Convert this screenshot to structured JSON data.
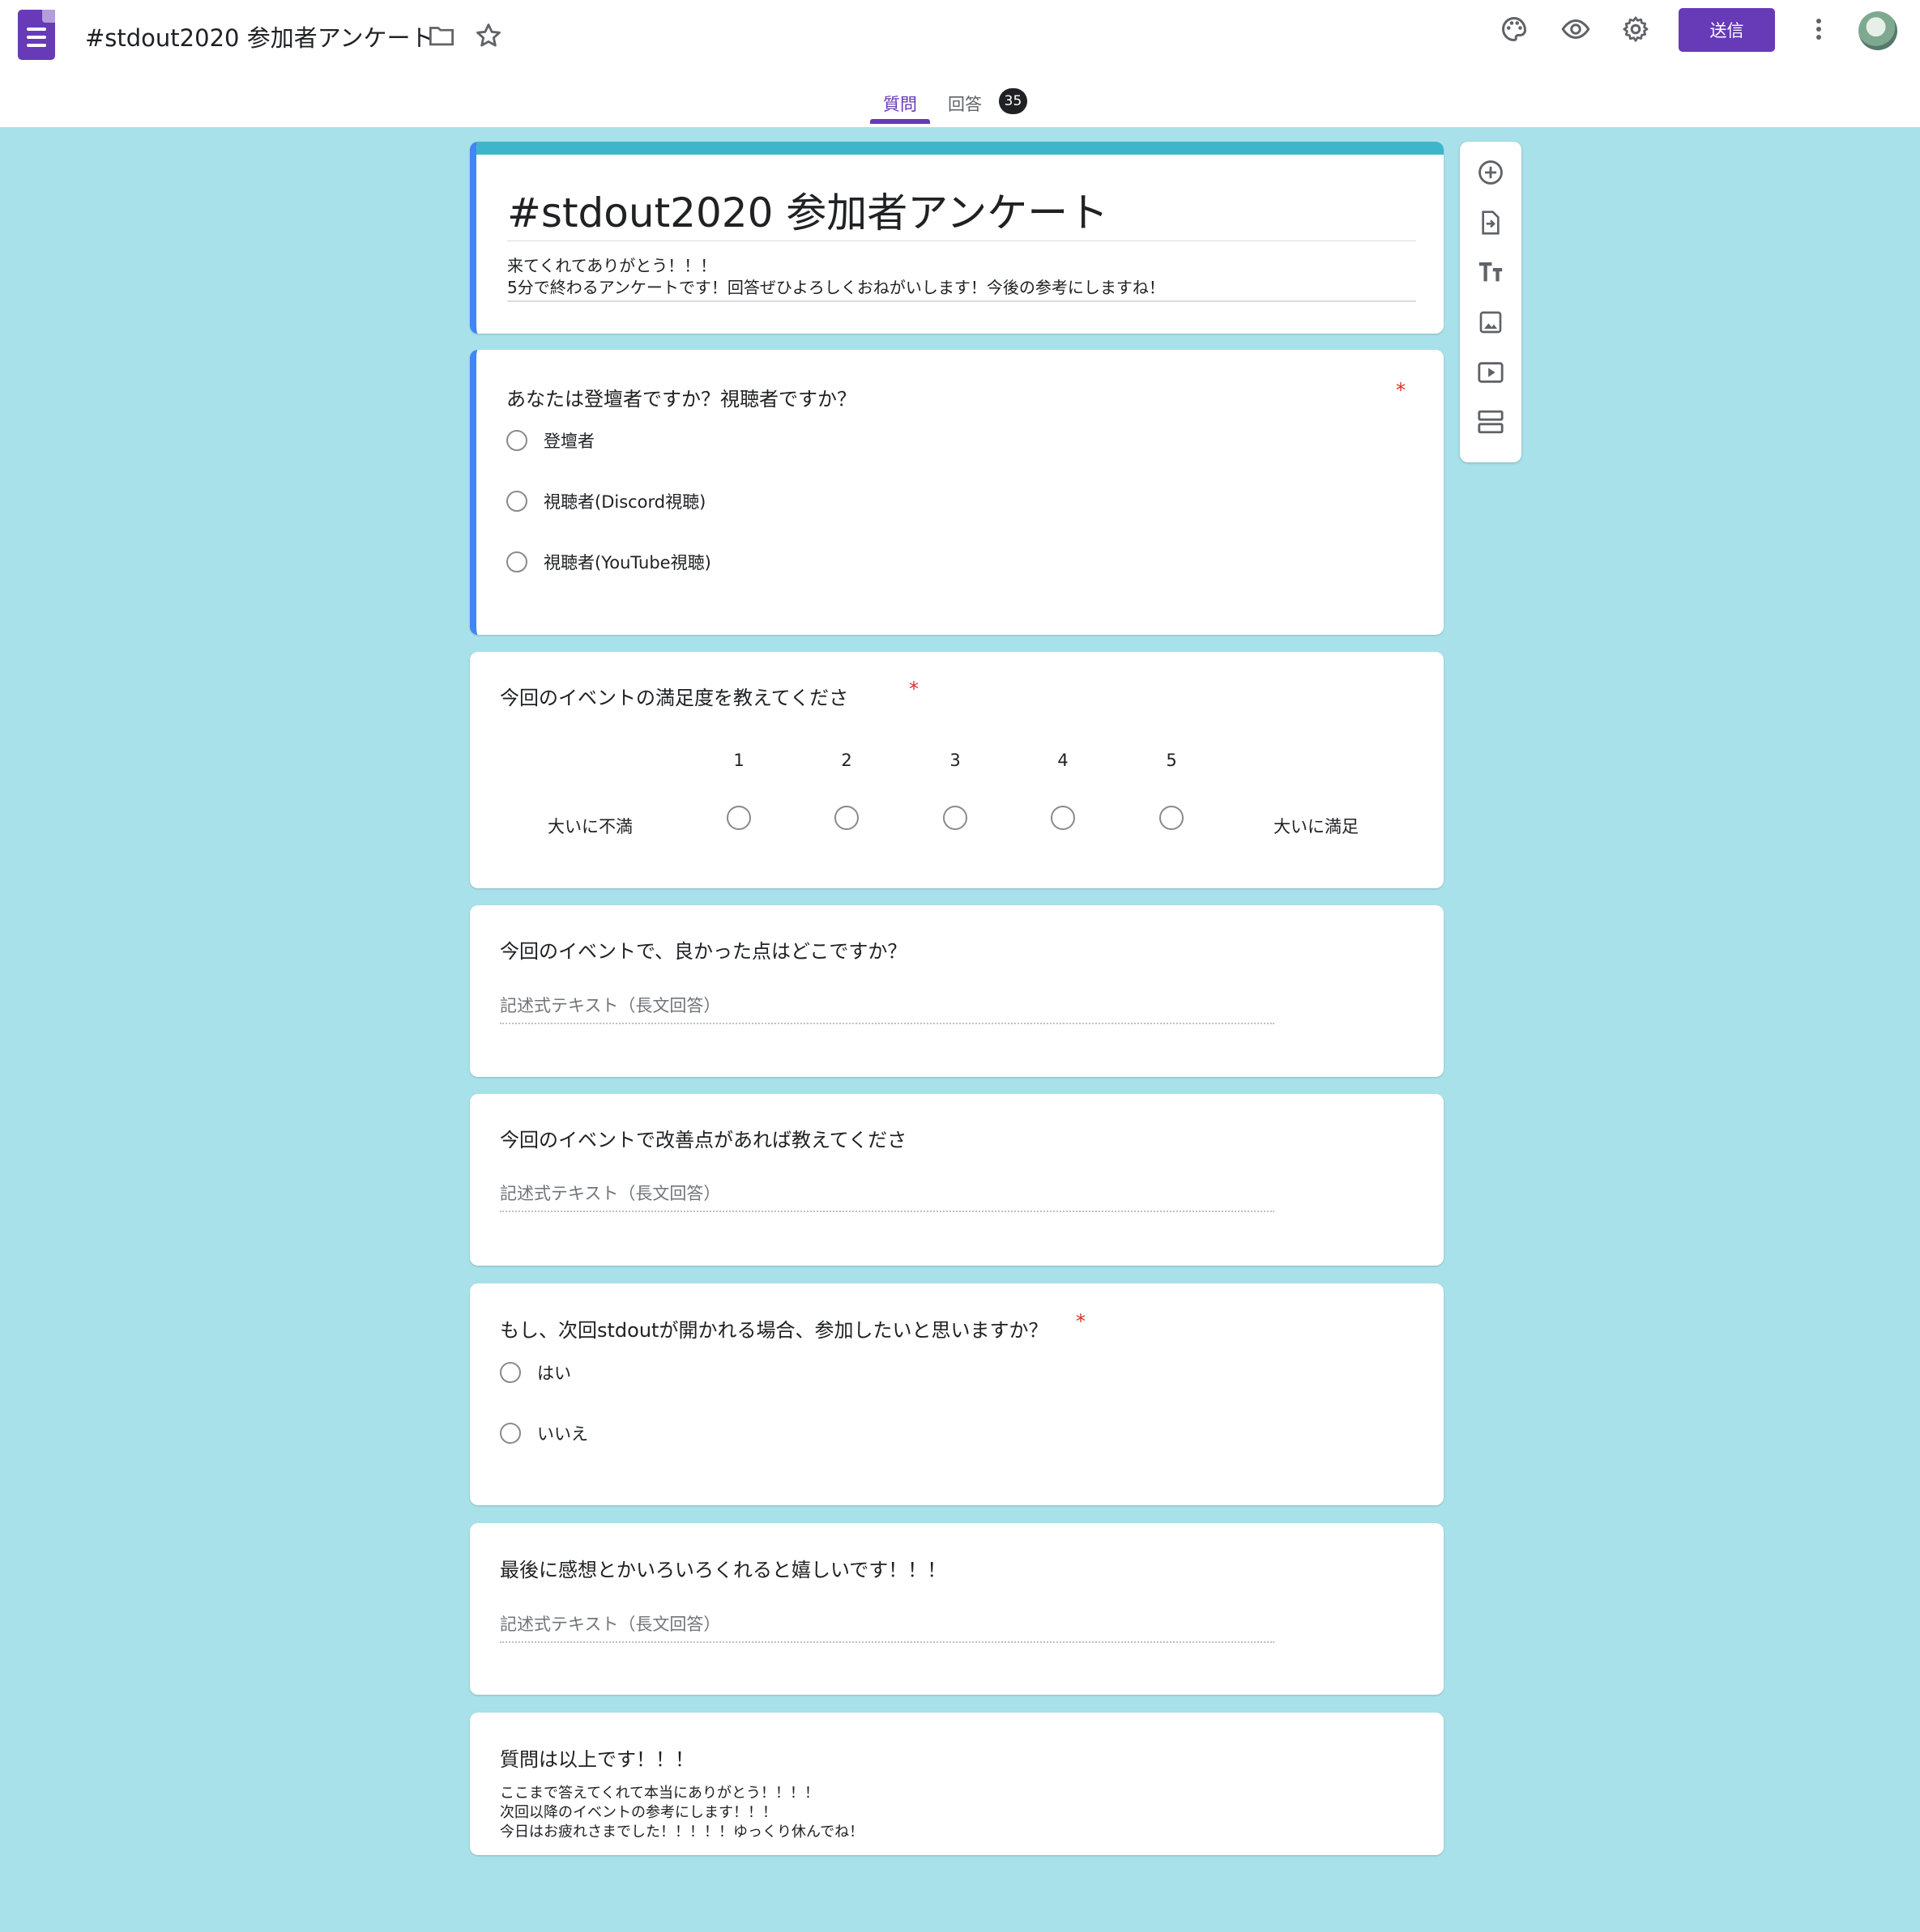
{
  "header": {
    "app_icon": "forms-icon",
    "doc_title": "#stdout2020 参加者アンケート",
    "icons": [
      "folder-icon",
      "star-icon",
      "palette-icon",
      "eye-icon",
      "gear-icon",
      "more-vert-icon"
    ],
    "send_label": "送信"
  },
  "tabs": {
    "questions_label": "質問",
    "responses_label": "回答",
    "responses_count": "35"
  },
  "form": {
    "title": "#stdout2020 参加者アンケート",
    "description_line1": "来てくれてありがとう！！！",
    "description_line2": "5分で終わるアンケートです！回答ぜひよろしくおねがいします！今後の参考にしますね！"
  },
  "questions": [
    {
      "title": "あなたは登壇者ですか？視聴者ですか？",
      "required_mark": "*",
      "options": [
        "登壇者",
        "視聴者(Discord視聴)",
        "視聴者(YouTube視聴)"
      ]
    },
    {
      "title": "今回のイベントの満足度を教えてくださ",
      "required_mark": "*",
      "scale": [
        "1",
        "2",
        "3",
        "4",
        "5"
      ],
      "min_label": "大いに不満",
      "max_label": "大いに満足"
    },
    {
      "title": "今回のイベントで、良かった点はどこですか？",
      "placeholder": "記述式テキスト（長文回答）"
    },
    {
      "title": "今回のイベントで改善点があれば教えてくださ",
      "placeholder": "記述式テキスト（長文回答）"
    },
    {
      "title": "もし、次回stdoutが開かれる場合、参加したいと思いますか？",
      "required_mark": "*",
      "options": [
        "はい",
        "いいえ"
      ]
    },
    {
      "title": "最後に感想とかいろいろくれると嬉しいです！！！",
      "placeholder": "記述式テキスト（長文回答）"
    }
  ],
  "ending": {
    "title": "質問は以上です！！！",
    "line1": "ここまで答えてくれて本当にありがとう！！！！",
    "line2": "次回以降のイベントの参考にします！！！",
    "line3": "今日はお疲れさまでした！！！！！ゆっくり休んでね！"
  },
  "toolbar": {
    "icons": [
      "add-question-icon",
      "import-questions-icon",
      "add-title-icon",
      "add-image-icon",
      "add-video-icon",
      "add-section-icon"
    ]
  },
  "colors": {
    "background": "#a8e1ea",
    "accent": "#673ab7",
    "title_bar": "#3fb5c9",
    "active_border": "#4285f4",
    "required": "#d93025"
  }
}
